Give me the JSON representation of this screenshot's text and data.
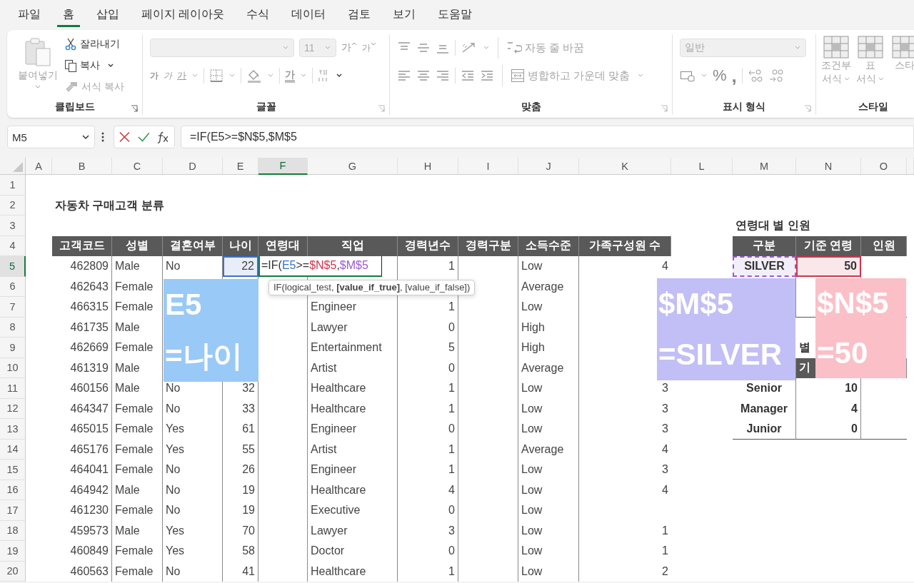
{
  "menu": [
    {
      "label": "파일",
      "selected": false
    },
    {
      "label": "홈",
      "selected": true
    },
    {
      "label": "삽입",
      "selected": false
    },
    {
      "label": "페이지 레이아웃",
      "selected": false
    },
    {
      "label": "수식",
      "selected": false
    },
    {
      "label": "데이터",
      "selected": false
    },
    {
      "label": "검토",
      "selected": false
    },
    {
      "label": "보기",
      "selected": false
    },
    {
      "label": "도움말",
      "selected": false
    }
  ],
  "ribbon": {
    "clipboard": {
      "label": "클립보드",
      "paste": {
        "label": "붙여넣기",
        "disabled": true
      },
      "cut": {
        "label": "잘라내기",
        "disabled": false
      },
      "copy": {
        "label": "복사",
        "disabled": false
      },
      "format_painter": {
        "label": "서식 복사",
        "disabled": true
      }
    },
    "font": {
      "label": "글꼴",
      "size": "11",
      "grow": "가",
      "shrink": "가",
      "bold": "가",
      "italic": "가",
      "underline": "가",
      "font_color": "가"
    },
    "alignment": {
      "label": "맞춤",
      "wrap": "자동 줄 바꿈",
      "merge": "병합하고 가운데 맞춤"
    },
    "number": {
      "label": "표시 형식",
      "format": "일반",
      "percent": "%",
      "comma": ","
    },
    "styles": {
      "label": "스타일",
      "items": [
        {
          "lines": [
            "조건부",
            "서식"
          ]
        },
        {
          "lines": [
            "표",
            "서식"
          ]
        },
        {
          "lines": [
            "스타"
          ]
        }
      ]
    }
  },
  "formula_bar": {
    "name_box": "M5",
    "formula": "=IF(E5>=$N$5,$M$5"
  },
  "sheet": {
    "columns": [
      {
        "label": "A",
        "selected": false
      },
      {
        "label": "B",
        "selected": false
      },
      {
        "label": "C",
        "selected": false
      },
      {
        "label": "D",
        "selected": false
      },
      {
        "label": "E",
        "selected": false
      },
      {
        "label": "F",
        "selected": true
      },
      {
        "label": "G",
        "selected": false
      },
      {
        "label": "H",
        "selected": false
      },
      {
        "label": "I",
        "selected": false
      },
      {
        "label": "J",
        "selected": false
      },
      {
        "label": "K",
        "selected": false
      },
      {
        "label": "L",
        "selected": false
      },
      {
        "label": "M",
        "selected": false
      },
      {
        "label": "N",
        "selected": false
      },
      {
        "label": "O",
        "selected": false
      }
    ],
    "rows": [
      {
        "label": "1",
        "selected": false
      },
      {
        "label": "2",
        "selected": false,
        "cells": [
          {},
          {
            "text": "자동차 구매고객 분류",
            "kind": "title"
          }
        ]
      },
      {
        "label": "3",
        "selected": false,
        "cells": [
          {},
          {},
          {},
          {},
          {},
          {},
          {},
          {},
          {},
          {},
          {},
          {},
          {
            "text": "연령대 별 인원",
            "kind": "title"
          }
        ]
      },
      {
        "label": "4",
        "selected": false,
        "cells": [
          {},
          {
            "text": "고객코드",
            "kind": "header"
          },
          {
            "text": "성별",
            "kind": "header"
          },
          {
            "text": "결혼여부",
            "kind": "header"
          },
          {
            "text": "나이",
            "kind": "header"
          },
          {
            "text": "연령대",
            "kind": "header"
          },
          {
            "text": "직업",
            "kind": "header"
          },
          {
            "text": "경력년수",
            "kind": "header"
          },
          {
            "text": "경력구분",
            "kind": "header"
          },
          {
            "text": "소득수준",
            "kind": "header"
          },
          {
            "text": "가족구성원 수",
            "kind": "header"
          },
          {},
          {
            "text": "구분",
            "kind": "header"
          },
          {
            "text": "기준 연령",
            "kind": "header"
          },
          {
            "text": "인원",
            "kind": "header"
          }
        ]
      },
      {
        "label": "5",
        "selected": true,
        "cells": [
          {},
          {
            "text": "462809",
            "kind": "num"
          },
          {
            "text": "Male",
            "kind": "text"
          },
          {
            "text": "No",
            "kind": "text"
          },
          {
            "text": "22",
            "kind": "num",
            "color": "#3a6fd0"
          },
          {
            "kind": "editing",
            "segments": [
              {
                "text": "=IF("
              },
              {
                "text": "E5",
                "color": "#3a6fd0"
              },
              {
                "text": ">="
              },
              {
                "text": "$N$5",
                "color": "#d1344b"
              },
              {
                "text": ","
              },
              {
                "text": "$M$5",
                "color": "#9b59d0"
              }
            ]
          },
          {},
          {
            "text": "1",
            "kind": "num"
          },
          {},
          {
            "text": "Low",
            "kind": "text"
          },
          {
            "text": "4",
            "kind": "num"
          },
          {},
          {
            "text": "SILVER",
            "kind": "bold",
            "color": "#9b59d0"
          },
          {
            "text": "50",
            "kind": "boldnum",
            "color": "#d1344b"
          }
        ]
      },
      {
        "label": "6",
        "selected": false,
        "cells": [
          {},
          {
            "text": "462643",
            "kind": "num"
          },
          {
            "text": "Female",
            "kind": "text"
          },
          {},
          {},
          {},
          {},
          {},
          {},
          {
            "text": "Average",
            "kind": "text"
          }
        ]
      },
      {
        "label": "7",
        "selected": false,
        "cells": [
          {},
          {
            "text": "466315",
            "kind": "num"
          },
          {
            "text": "Female",
            "kind": "text"
          },
          {},
          {},
          {},
          {
            "text": "Engineer",
            "kind": "text"
          },
          {
            "text": "1",
            "kind": "num"
          },
          {},
          {
            "text": "Low",
            "kind": "text"
          }
        ]
      },
      {
        "label": "8",
        "selected": false,
        "cells": [
          {},
          {
            "text": "461735",
            "kind": "num"
          },
          {
            "text": "Male",
            "kind": "text"
          },
          {},
          {},
          {},
          {
            "text": "Lawyer",
            "kind": "text"
          },
          {
            "text": "0",
            "kind": "num"
          },
          {},
          {
            "text": "High",
            "kind": "text"
          }
        ]
      },
      {
        "label": "9",
        "selected": false,
        "cells": [
          {},
          {
            "text": "462669",
            "kind": "num"
          },
          {
            "text": "Female",
            "kind": "text"
          },
          {},
          {},
          {},
          {
            "text": "Entertainment",
            "kind": "text"
          },
          {
            "text": "5",
            "kind": "num"
          },
          {},
          {
            "text": "High",
            "kind": "text"
          },
          {},
          {},
          {},
          {
            "text": "별",
            "kind": "title"
          }
        ]
      },
      {
        "label": "10",
        "selected": false,
        "cells": [
          {},
          {
            "text": "461319",
            "kind": "num"
          },
          {
            "text": "Male",
            "kind": "text"
          },
          {},
          {},
          {},
          {
            "text": "Artist",
            "kind": "text"
          },
          {
            "text": "0",
            "kind": "num"
          },
          {},
          {
            "text": "Average",
            "kind": "text"
          },
          {},
          {},
          {
            "kind": "header"
          },
          {
            "text": "기",
            "kind": "header-left"
          },
          {
            "kind": "header"
          }
        ]
      },
      {
        "label": "11",
        "selected": false,
        "cells": [
          {},
          {
            "text": "460156",
            "kind": "num"
          },
          {
            "text": "Male",
            "kind": "text"
          },
          {
            "text": "No",
            "kind": "text"
          },
          {
            "text": "32",
            "kind": "num"
          },
          {},
          {
            "text": "Healthcare",
            "kind": "text"
          },
          {
            "text": "1",
            "kind": "num"
          },
          {},
          {
            "text": "Low",
            "kind": "text"
          },
          {
            "text": "3",
            "kind": "num"
          },
          {},
          {
            "text": "Senior",
            "kind": "bold"
          },
          {
            "text": "10",
            "kind": "boldnum"
          }
        ]
      },
      {
        "label": "12",
        "selected": false,
        "cells": [
          {},
          {
            "text": "464347",
            "kind": "num"
          },
          {
            "text": "Female",
            "kind": "text"
          },
          {
            "text": "No",
            "kind": "text"
          },
          {
            "text": "33",
            "kind": "num"
          },
          {},
          {
            "text": "Healthcare",
            "kind": "text"
          },
          {
            "text": "1",
            "kind": "num"
          },
          {},
          {
            "text": "Low",
            "kind": "text"
          },
          {
            "text": "3",
            "kind": "num"
          },
          {},
          {
            "text": "Manager",
            "kind": "bold"
          },
          {
            "text": "4",
            "kind": "boldnum"
          }
        ]
      },
      {
        "label": "13",
        "selected": false,
        "cells": [
          {},
          {
            "text": "465015",
            "kind": "num"
          },
          {
            "text": "Female",
            "kind": "text"
          },
          {
            "text": "Yes",
            "kind": "text"
          },
          {
            "text": "61",
            "kind": "num"
          },
          {},
          {
            "text": "Engineer",
            "kind": "text"
          },
          {
            "text": "0",
            "kind": "num"
          },
          {},
          {
            "text": "Low",
            "kind": "text"
          },
          {
            "text": "3",
            "kind": "num"
          },
          {},
          {
            "text": "Junior",
            "kind": "bold"
          },
          {
            "text": "0",
            "kind": "boldnum"
          }
        ]
      },
      {
        "label": "14",
        "selected": false,
        "cells": [
          {},
          {
            "text": "465176",
            "kind": "num"
          },
          {
            "text": "Female",
            "kind": "text"
          },
          {
            "text": "Yes",
            "kind": "text"
          },
          {
            "text": "55",
            "kind": "num"
          },
          {},
          {
            "text": "Artist",
            "kind": "text"
          },
          {
            "text": "1",
            "kind": "num"
          },
          {},
          {
            "text": "Average",
            "kind": "text"
          },
          {
            "text": "4",
            "kind": "num"
          }
        ]
      },
      {
        "label": "15",
        "selected": false,
        "cells": [
          {},
          {
            "text": "464041",
            "kind": "num"
          },
          {
            "text": "Female",
            "kind": "text"
          },
          {
            "text": "No",
            "kind": "text"
          },
          {
            "text": "26",
            "kind": "num"
          },
          {},
          {
            "text": "Engineer",
            "kind": "text"
          },
          {
            "text": "1",
            "kind": "num"
          },
          {},
          {
            "text": "Low",
            "kind": "text"
          },
          {
            "text": "3",
            "kind": "num"
          }
        ]
      },
      {
        "label": "16",
        "selected": false,
        "cells": [
          {},
          {
            "text": "464942",
            "kind": "num"
          },
          {
            "text": "Male",
            "kind": "text"
          },
          {
            "text": "No",
            "kind": "text"
          },
          {
            "text": "19",
            "kind": "num"
          },
          {},
          {
            "text": "Healthcare",
            "kind": "text"
          },
          {
            "text": "4",
            "kind": "num"
          },
          {},
          {
            "text": "Low",
            "kind": "text"
          },
          {
            "text": "4",
            "kind": "num"
          }
        ]
      },
      {
        "label": "17",
        "selected": false,
        "cells": [
          {},
          {
            "text": "461230",
            "kind": "num"
          },
          {
            "text": "Female",
            "kind": "text"
          },
          {
            "text": "No",
            "kind": "text"
          },
          {
            "text": "19",
            "kind": "num"
          },
          {},
          {
            "text": "Executive",
            "kind": "text"
          },
          {
            "text": "0",
            "kind": "num"
          },
          {},
          {
            "text": "Low",
            "kind": "text"
          }
        ]
      },
      {
        "label": "18",
        "selected": false,
        "cells": [
          {},
          {
            "text": "459573",
            "kind": "num"
          },
          {
            "text": "Male",
            "kind": "text"
          },
          {
            "text": "Yes",
            "kind": "text"
          },
          {
            "text": "70",
            "kind": "num"
          },
          {},
          {
            "text": "Lawyer",
            "kind": "text"
          },
          {
            "text": "3",
            "kind": "num"
          },
          {},
          {
            "text": "Low",
            "kind": "text"
          },
          {
            "text": "1",
            "kind": "num"
          }
        ]
      },
      {
        "label": "19",
        "selected": false,
        "cells": [
          {},
          {
            "text": "460849",
            "kind": "num"
          },
          {
            "text": "Female",
            "kind": "text"
          },
          {
            "text": "Yes",
            "kind": "text"
          },
          {
            "text": "58",
            "kind": "num"
          },
          {},
          {
            "text": "Doctor",
            "kind": "text"
          },
          {
            "text": "0",
            "kind": "num"
          },
          {},
          {
            "text": "Low",
            "kind": "text"
          },
          {
            "text": "1",
            "kind": "num"
          }
        ]
      },
      {
        "label": "20",
        "selected": false,
        "cells": [
          {},
          {
            "text": "460563",
            "kind": "num"
          },
          {
            "text": "Female",
            "kind": "text"
          },
          {
            "text": "No",
            "kind": "text"
          },
          {
            "text": "41",
            "kind": "num"
          },
          {},
          {
            "text": "Healthcare",
            "kind": "text"
          },
          {
            "text": "1",
            "kind": "num"
          },
          {},
          {
            "text": "Low",
            "kind": "text"
          },
          {
            "text": "2",
            "kind": "num"
          }
        ]
      }
    ]
  },
  "tooltip": "IF(logical_test, **[value_if_true]**, [value_if_false])",
  "callouts": [
    {
      "lines": [
        "E5",
        "=나이"
      ],
      "color": "#99c9f7"
    },
    {
      "lines": [
        "$M$5",
        "=SILVER"
      ],
      "color": "#c2bef6"
    },
    {
      "lines": [
        "$N$5",
        "=50"
      ],
      "color": "#fbbfc7"
    }
  ]
}
